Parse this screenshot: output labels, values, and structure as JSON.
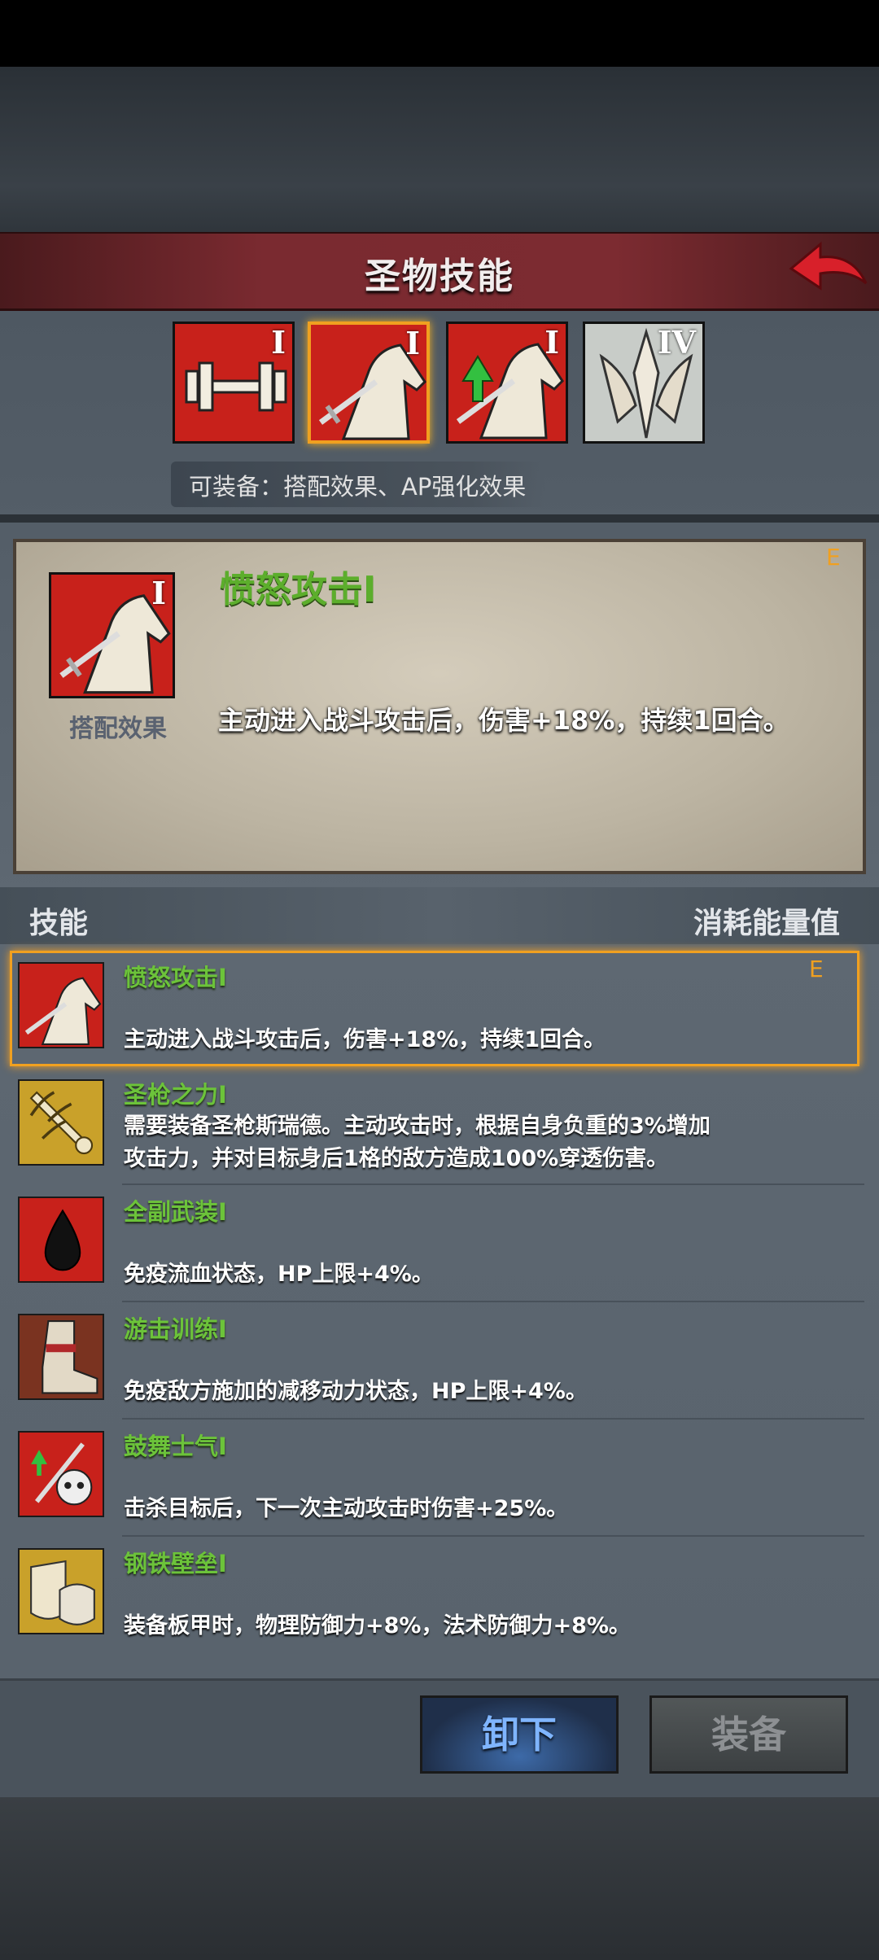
{
  "header": {
    "title": "圣物技能"
  },
  "relic_icons": [
    {
      "tier": "I",
      "icon": "dumbbell-icon"
    },
    {
      "tier": "I",
      "icon": "horse-sword-icon"
    },
    {
      "tier": "I",
      "icon": "horse-sword-up-icon"
    },
    {
      "tier": "IV",
      "icon": "spear-crest-icon"
    }
  ],
  "equip_hint": "可装备：搭配效果、AP强化效果",
  "detail": {
    "tier_badge": "E",
    "name": "愤怒攻击I",
    "icon_tier": "I",
    "subtitle": "搭配效果",
    "description": "主动进入战斗攻击后，伤害+18%，持续1回合。"
  },
  "list_header": {
    "left": "技能",
    "right": "消耗能量值"
  },
  "skills": [
    {
      "name": "愤怒攻击I",
      "desc": "主动进入战斗攻击后，伤害+18%，持续1回合。",
      "badge": "E"
    },
    {
      "name": "圣枪之力I",
      "desc_line1": "需要装备圣枪斯瑞德。主动攻击时，根据自身负重的3%增加",
      "desc_line2": "攻击力，并对目标身后1格的敌方造成100%穿透伤害。"
    },
    {
      "name": "全副武装I",
      "desc": "免疫流血状态，HP上限+4%。"
    },
    {
      "name": "游击训练I",
      "desc": "免疫敌方施加的减移动力状态，HP上限+4%。"
    },
    {
      "name": "鼓舞士气I",
      "desc": "击杀目标后，下一次主动攻击时伤害+25%。"
    },
    {
      "name": "钢铁壁垒I",
      "desc": "装备板甲时，物理防御力+8%，法术防御力+8%。"
    }
  ],
  "buttons": {
    "unequip": "卸下",
    "equip": "装备"
  },
  "colors": {
    "accent_gold": "#f0a020",
    "skill_green": "#6cc33a",
    "header_red": "#7a2a30"
  }
}
